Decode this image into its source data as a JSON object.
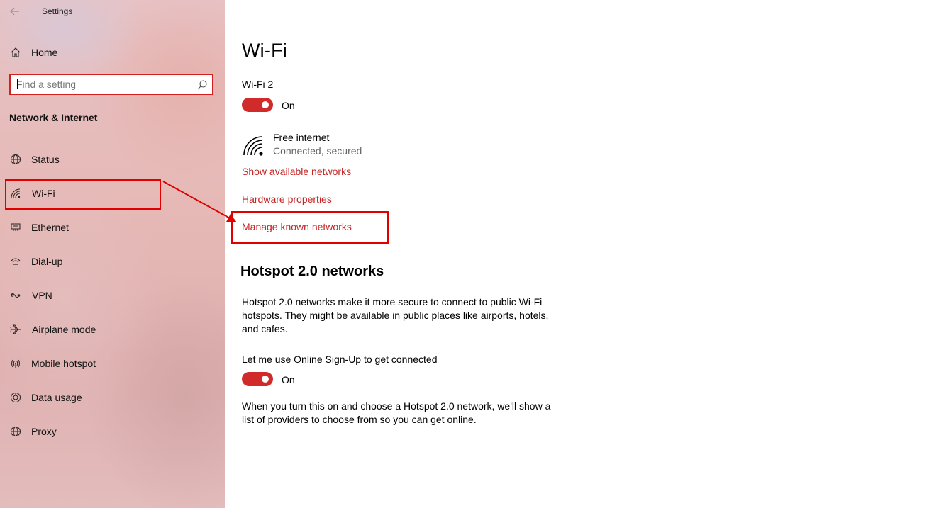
{
  "app": {
    "title": "Settings"
  },
  "sidebar": {
    "home_label": "Home",
    "search": {
      "placeholder": "Find a setting",
      "value": ""
    },
    "section_title": "Network & Internet",
    "items": [
      {
        "label": "Status",
        "icon": "globe-network-icon"
      },
      {
        "label": "Wi-Fi",
        "icon": "wifi-icon",
        "selected": true
      },
      {
        "label": "Ethernet",
        "icon": "ethernet-icon"
      },
      {
        "label": "Dial-up",
        "icon": "dial-up-icon"
      },
      {
        "label": "VPN",
        "icon": "vpn-icon"
      },
      {
        "label": "Airplane mode",
        "icon": "airplane-icon"
      },
      {
        "label": "Mobile hotspot",
        "icon": "hotspot-icon"
      },
      {
        "label": "Data usage",
        "icon": "data-usage-icon"
      },
      {
        "label": "Proxy",
        "icon": "globe-icon"
      }
    ]
  },
  "main": {
    "title": "Wi-Fi",
    "adapter": {
      "label": "Wi-Fi 2",
      "toggle_state": "On"
    },
    "network": {
      "name": "Free internet",
      "status": "Connected, secured"
    },
    "links": {
      "show_networks": "Show available networks",
      "hardware": "Hardware properties",
      "manage": "Manage known networks"
    },
    "hotspot": {
      "heading": "Hotspot 2.0 networks",
      "description": "Hotspot 2.0 networks make it more secure to connect to public Wi-Fi hotspots. They might be available in public places like airports, hotels, and cafes.",
      "signup_label": "Let me use Online Sign-Up to get connected",
      "signup_toggle_state": "On",
      "footer": "When you turn this on and choose a Hotspot 2.0 network, we'll show a list of providers to choose from so you can get online."
    }
  },
  "colors": {
    "accent": "#d02a2a",
    "link": "#c42424",
    "annotation": "#e00000"
  }
}
